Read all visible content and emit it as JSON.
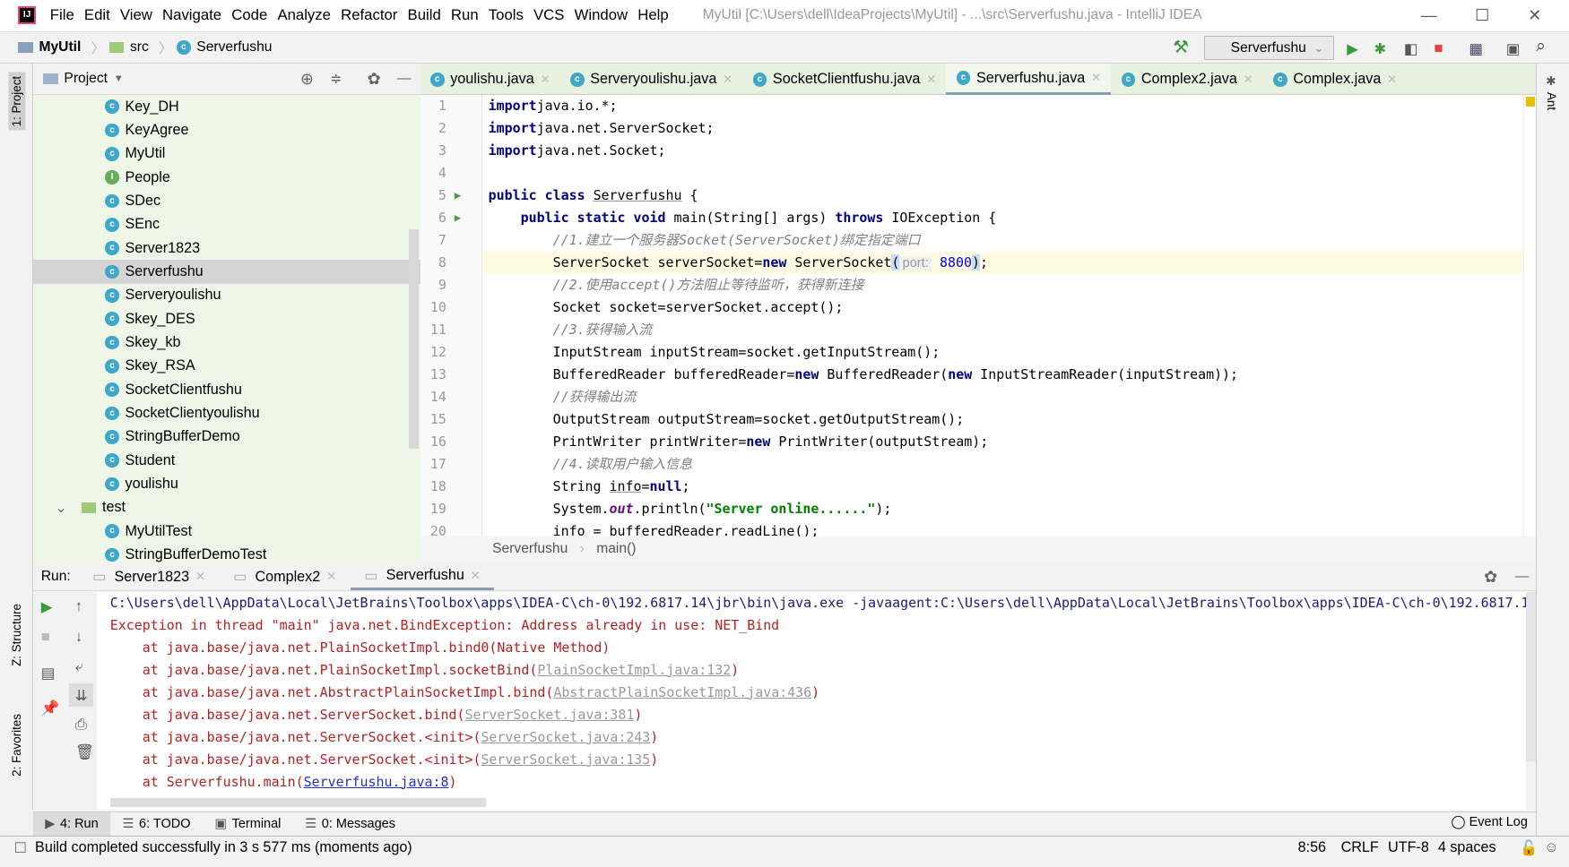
{
  "window": {
    "title": "MyUtil [C:\\Users\\dell\\IdeaProjects\\MyUtil] - ...\\src\\Serverfushu.java - IntelliJ IDEA"
  },
  "menu": [
    "File",
    "Edit",
    "View",
    "Navigate",
    "Code",
    "Analyze",
    "Refactor",
    "Build",
    "Run",
    "Tools",
    "VCS",
    "Window",
    "Help"
  ],
  "breadcrumb": [
    "MyUtil",
    "src",
    "Serverfushu"
  ],
  "toolbar": {
    "run_config": "Serverfushu"
  },
  "left_strip": {
    "project": "1: Project",
    "structure": "Z: Structure",
    "favorites": "2: Favorites"
  },
  "right_strip": {
    "ant": "Ant"
  },
  "project": {
    "title": "Project",
    "items": [
      {
        "label": "Key_DH",
        "icon": "class-icon"
      },
      {
        "label": "KeyAgree",
        "icon": "class-icon"
      },
      {
        "label": "MyUtil",
        "icon": "class-icon"
      },
      {
        "label": "People",
        "icon": "interface-icon"
      },
      {
        "label": "SDec",
        "icon": "class-icon"
      },
      {
        "label": "SEnc",
        "icon": "class-icon"
      },
      {
        "label": "Server1823",
        "icon": "class-icon"
      },
      {
        "label": "Serverfushu",
        "icon": "class-icon",
        "selected": true
      },
      {
        "label": "Serveryoulishu",
        "icon": "class-icon"
      },
      {
        "label": "Skey_DES",
        "icon": "class-icon"
      },
      {
        "label": "Skey_kb",
        "icon": "class-icon"
      },
      {
        "label": "Skey_RSA",
        "icon": "class-icon"
      },
      {
        "label": "SocketClientfushu",
        "icon": "class-icon"
      },
      {
        "label": "SocketClientyoulishu",
        "icon": "class-icon"
      },
      {
        "label": "StringBufferDemo",
        "icon": "class-icon"
      },
      {
        "label": "Student",
        "icon": "class-icon"
      },
      {
        "label": "youlishu",
        "icon": "class-icon"
      },
      {
        "label": "test",
        "icon": "folder-icon",
        "dir": true
      },
      {
        "label": "MyUtilTest",
        "icon": "class-icon"
      },
      {
        "label": "StringBufferDemoTest",
        "icon": "class-icon"
      }
    ]
  },
  "editor_tabs": [
    {
      "label": "youlishu.java"
    },
    {
      "label": "Serveryoulishu.java"
    },
    {
      "label": "SocketClientfushu.java"
    },
    {
      "label": "Serverfushu.java",
      "active": true
    },
    {
      "label": "Complex2.java"
    },
    {
      "label": "Complex.java"
    }
  ],
  "code": [
    [
      [
        "kw",
        "import"
      ],
      [
        "",
        "java.io.*;"
      ]
    ],
    [
      [
        "kw",
        "import"
      ],
      [
        "",
        "java.net.ServerSocket;"
      ]
    ],
    [
      [
        "kw",
        "import"
      ],
      [
        "",
        "java.net.Socket;"
      ]
    ],
    [],
    [
      [
        "kw",
        "public class "
      ],
      [
        "ul",
        "Serverfushu"
      ],
      [
        "",
        " {"
      ]
    ],
    [
      [
        "",
        "    "
      ],
      [
        "kw",
        "public static void "
      ],
      [
        "",
        "main(String[] args) "
      ],
      [
        "kw",
        "throws "
      ],
      [
        "",
        "IOException {"
      ]
    ],
    [
      [
        "cm",
        "        //1.建立一个服务器Socket(ServerSocket)绑定指定端口"
      ]
    ],
    [
      [
        "",
        "        ServerSocket serverSocket="
      ],
      [
        "kw",
        "new "
      ],
      [
        "",
        "ServerSocket"
      ],
      [
        "br",
        "("
      ],
      [
        "hint",
        "port:"
      ],
      [
        "",
        " "
      ],
      [
        "num",
        "8800"
      ],
      [
        "br",
        ")"
      ],
      [
        "",
        ";"
      ]
    ],
    [
      [
        "cm",
        "        //2.使用accept()方法阻止等待监听，获得新连接"
      ]
    ],
    [
      [
        "",
        "        Socket socket=serverSocket.accept();"
      ]
    ],
    [
      [
        "cm",
        "        //3.获得输入流"
      ]
    ],
    [
      [
        "",
        "        InputStream inputStream=socket.getInputStream();"
      ]
    ],
    [
      [
        "",
        "        BufferedReader bufferedReader="
      ],
      [
        "kw",
        "new "
      ],
      [
        "",
        "BufferedReader("
      ],
      [
        "kw",
        "new "
      ],
      [
        "",
        "InputStreamReader(inputStream));"
      ]
    ],
    [
      [
        "cm",
        "        //获得输出流"
      ]
    ],
    [
      [
        "",
        "        OutputStream outputStream=socket.getOutputStream();"
      ]
    ],
    [
      [
        "",
        "        PrintWriter printWriter="
      ],
      [
        "kw",
        "new "
      ],
      [
        "",
        "PrintWriter(outputStream);"
      ]
    ],
    [
      [
        "cm",
        "        //4.读取用户输入信息"
      ]
    ],
    [
      [
        "",
        "        String "
      ],
      [
        "ul",
        "info"
      ],
      [
        "",
        "="
      ],
      [
        "kw",
        "null"
      ],
      [
        "",
        ";"
      ]
    ],
    [
      [
        "",
        "        System."
      ],
      [
        "it",
        "out"
      ],
      [
        "",
        ".println("
      ],
      [
        "st",
        "\"Server online......\""
      ],
      [
        "",
        ");"
      ]
    ],
    [
      [
        "",
        "        info = bufferedReader.readLine();"
      ]
    ]
  ],
  "current_line": 8,
  "editor_breadcrumb": [
    "Serverfushu",
    "main()"
  ],
  "run": {
    "label": "Run:",
    "tabs": [
      {
        "label": "Server1823"
      },
      {
        "label": "Complex2"
      },
      {
        "label": "Serverfushu",
        "active": true
      }
    ],
    "output": [
      {
        "type": "cmd",
        "text": "C:\\Users\\dell\\AppData\\Local\\JetBrains\\Toolbox\\apps\\IDEA-C\\ch-0\\192.6817.14\\jbr\\bin\\java.exe -javaagent:C:\\Users\\dell\\AppData\\Local\\JetBrains\\Toolbox\\apps\\IDEA-C\\ch-0\\192.6817.14"
      },
      {
        "type": "err",
        "text": "Exception in thread \"main\" java.net.BindException: Address already in use: NET_Bind"
      },
      {
        "type": "err",
        "text": "    at java.base/java.net.PlainSocketImpl.bind0(Native Method)"
      },
      {
        "type": "err",
        "text": "    at java.base/java.net.PlainSocketImpl.socketBind(",
        "link": "PlainSocketImpl.java:132",
        "tail": ")"
      },
      {
        "type": "err",
        "text": "    at java.base/java.net.AbstractPlainSocketImpl.bind(",
        "link": "AbstractPlainSocketImpl.java:436",
        "tail": ")"
      },
      {
        "type": "err",
        "text": "    at java.base/java.net.ServerSocket.bind(",
        "link": "ServerSocket.java:381",
        "tail": ")"
      },
      {
        "type": "err",
        "text": "    at java.base/java.net.ServerSocket.<init>(",
        "link": "ServerSocket.java:243",
        "tail": ")"
      },
      {
        "type": "err",
        "text": "    at java.base/java.net.ServerSocket.<init>(",
        "link": "ServerSocket.java:135",
        "tail": ")"
      },
      {
        "type": "err",
        "text": "    at Serverfushu.main(",
        "link": "Serverfushu.java:8",
        "tail": ")",
        "link_blue": true
      }
    ]
  },
  "bottom_tabs": [
    {
      "label": "4: Run",
      "active": true
    },
    {
      "label": "6: TODO"
    },
    {
      "label": "Terminal"
    },
    {
      "label": "0: Messages"
    }
  ],
  "event_log": "Event Log",
  "status": {
    "message": "Build completed successfully in 3 s 577 ms (moments ago)",
    "position": "8:56",
    "line_sep": "CRLF",
    "encoding": "UTF-8",
    "indent": "4 spaces"
  }
}
